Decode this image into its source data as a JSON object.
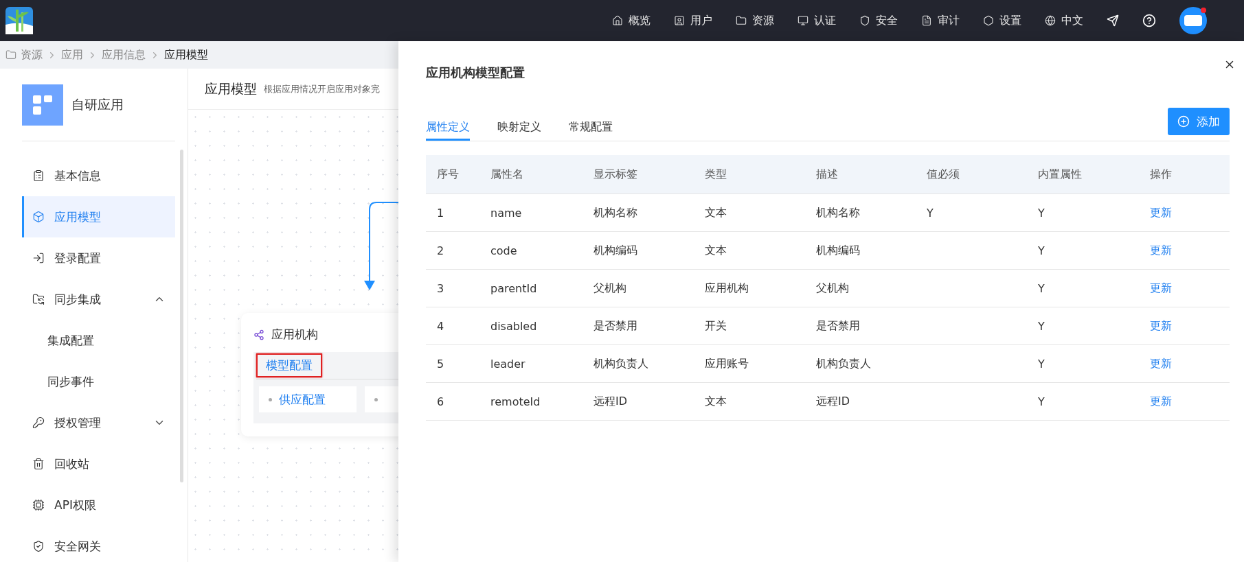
{
  "top_nav": {
    "items": [
      {
        "label": "概览"
      },
      {
        "label": "用户"
      },
      {
        "label": "资源"
      },
      {
        "label": "认证"
      },
      {
        "label": "安全"
      },
      {
        "label": "审计"
      },
      {
        "label": "设置"
      },
      {
        "label": "中文"
      }
    ],
    "has_notification": true
  },
  "breadcrumb": [
    "资源",
    "应用",
    "应用信息",
    "应用模型"
  ],
  "sidebar": {
    "app_name": "自研应用",
    "items": [
      {
        "label": "基本信息",
        "selected": false
      },
      {
        "label": "应用模型",
        "selected": true
      },
      {
        "label": "登录配置",
        "selected": false
      },
      {
        "label": "同步集成",
        "selected": false,
        "expanded": true,
        "children": [
          {
            "label": "集成配置",
            "selected": false
          },
          {
            "label": "同步事件",
            "selected": false
          }
        ]
      },
      {
        "label": "授权管理",
        "selected": false,
        "expanded": false
      },
      {
        "label": "回收站",
        "selected": false
      },
      {
        "label": "API权限",
        "selected": false
      },
      {
        "label": "安全网关",
        "selected": false
      }
    ]
  },
  "main": {
    "title": "应用模型",
    "description": "根据应用情况开启应用对象完",
    "node": {
      "title": "应用机构",
      "tab": "模型配置",
      "tab_highlighted": true,
      "chips": [
        {
          "kind": "label",
          "label": "供应配置"
        },
        {
          "kind": "clipped"
        }
      ]
    }
  },
  "drawer": {
    "title": "应用机构模型配置",
    "tabs": [
      {
        "label": "属性定义",
        "selected": true
      },
      {
        "label": "映射定义",
        "selected": false
      },
      {
        "label": "常规配置",
        "selected": false
      }
    ],
    "add_button": "添加",
    "table": {
      "columns": [
        "序号",
        "属性名",
        "显示标签",
        "类型",
        "描述",
        "值必须",
        "内置属性",
        "操作"
      ],
      "rows": [
        {
          "cells": [
            "1",
            "name",
            "机构名称",
            "文本",
            "机构名称",
            "Y",
            "Y"
          ],
          "action": "更新"
        },
        {
          "cells": [
            "2",
            "code",
            "机构编码",
            "文本",
            "机构编码",
            "",
            "Y"
          ],
          "action": "更新"
        },
        {
          "cells": [
            "3",
            "parentId",
            "父机构",
            "应用机构",
            "父机构",
            "",
            "Y"
          ],
          "action": "更新"
        },
        {
          "cells": [
            "4",
            "disabled",
            "是否禁用",
            "开关",
            "是否禁用",
            "",
            "Y"
          ],
          "action": "更新"
        },
        {
          "cells": [
            "5",
            "leader",
            "机构负责人",
            "应用账号",
            "机构负责人",
            "",
            "Y"
          ],
          "action": "更新"
        },
        {
          "cells": [
            "6",
            "remoteId",
            "远程ID",
            "文本",
            "远程ID",
            "",
            "Y"
          ],
          "action": "更新"
        }
      ]
    }
  }
}
